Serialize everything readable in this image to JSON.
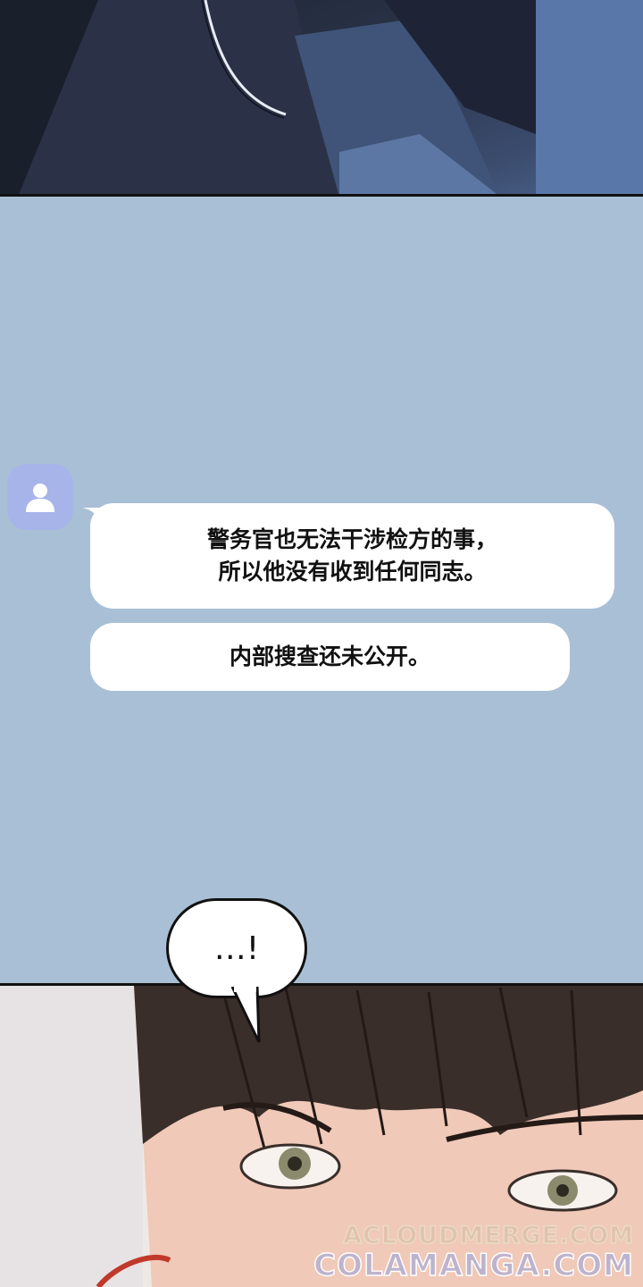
{
  "messages": {
    "msg1_line1": "警务官也无法干涉检方的事，",
    "msg1_line2": "所以他没有收到任何同志。",
    "msg2": "内部搜查还未公开。"
  },
  "speech_bubble": {
    "text": "…!"
  },
  "watermarks": {
    "line1": "ACLOUDMERGE.COM",
    "line2": "COLAMANGA.COM"
  },
  "icons": {
    "avatar": "person-icon"
  },
  "colors": {
    "gutter": "#a9bfd6",
    "bubble": "#ffffff",
    "avatar_bg": "#a7b4ea"
  }
}
